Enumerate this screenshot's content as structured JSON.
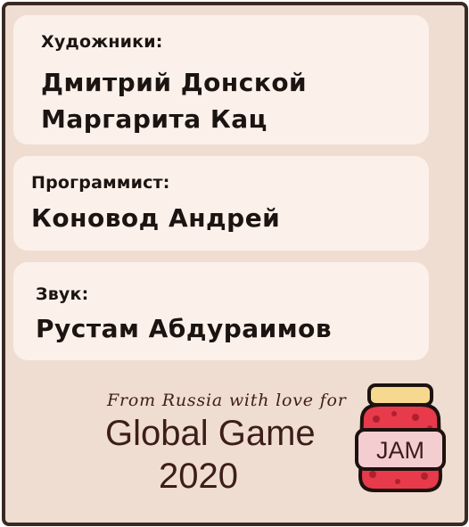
{
  "credits": {
    "artists": {
      "label": "Художники:",
      "names": [
        "Дмитрий Донской",
        "Маргарита Кац"
      ]
    },
    "programmer": {
      "label": "Программист:",
      "name": "Коновод Андрей"
    },
    "sound": {
      "label": "Звук:",
      "name": "Рустам Абдураимов"
    }
  },
  "jam": {
    "tagline": "From Russia with love for",
    "title": "Global Game",
    "year": "2020",
    "logo_text": "JAM",
    "logo_icon": "jam-jar-icon"
  },
  "colors": {
    "panel_background": "#efddd1",
    "card_background": "#fbf0ea",
    "border": "#3a2a22",
    "jar_red": "#e73a4a",
    "jar_lid": "#f6d88e"
  }
}
